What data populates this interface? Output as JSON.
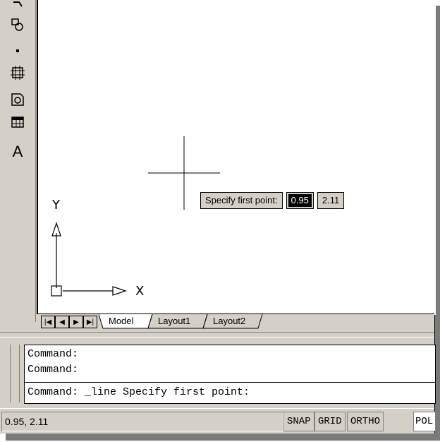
{
  "toolbar": {
    "items": [
      {
        "icon": "drawing-tools-icon"
      },
      {
        "icon": "insert-block-icon"
      },
      {
        "icon": "point-icon"
      },
      {
        "icon": "hatch-icon"
      },
      {
        "icon": "region-icon"
      },
      {
        "icon": "table-icon"
      },
      {
        "icon": "text-icon",
        "label": "A"
      }
    ]
  },
  "tooltip": {
    "prompt": "Specify first point:",
    "x_value": "0.95",
    "y_value": "2.11"
  },
  "ucs": {
    "x_label": "X",
    "y_label": "Y"
  },
  "tabs": {
    "items": [
      "Model",
      "Layout1",
      "Layout2"
    ],
    "active": "Model"
  },
  "command": {
    "history": [
      "Command:",
      "Command:"
    ],
    "current": "Command: _line Specify first point:"
  },
  "status": {
    "coordinates": "0.95, 2.11",
    "buttons": [
      "SNAP",
      "GRID",
      "ORTHO",
      "POL"
    ]
  }
}
